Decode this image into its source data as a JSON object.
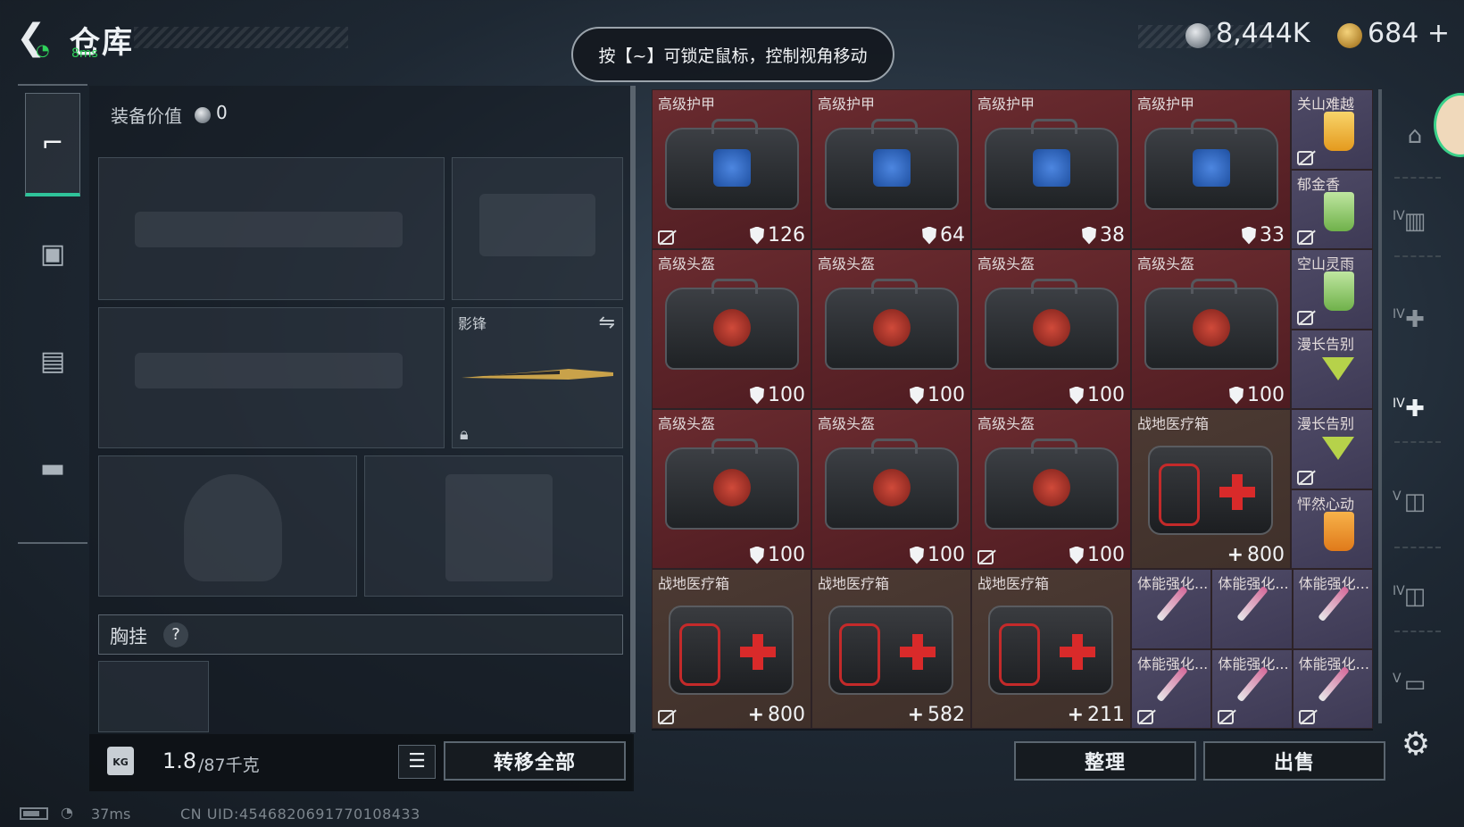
{
  "header": {
    "title": "仓库",
    "ping": "8ms",
    "hint": "按【~】可锁定鼠标，控制视角移动",
    "silver_amount": "8,444K",
    "gold_amount": "684",
    "gold_plus": "+"
  },
  "equipment": {
    "value_label": "装备价值",
    "value": "0",
    "melee_name": "影锋",
    "chest_label": "胸挂",
    "help": "?"
  },
  "weight": {
    "icon_text": "KG",
    "current": "1.8",
    "max": "/87千克"
  },
  "buttons": {
    "transfer_all": "转移全部",
    "sort": "整理",
    "sell": "出售"
  },
  "inventory": {
    "large": [
      {
        "name": "高级护甲",
        "count": "126",
        "type": "armor",
        "nodrop": true
      },
      {
        "name": "高级护甲",
        "count": "64",
        "type": "armor",
        "nodrop": false
      },
      {
        "name": "高级护甲",
        "count": "38",
        "type": "armor",
        "nodrop": false
      },
      {
        "name": "高级护甲",
        "count": "33",
        "type": "armor",
        "nodrop": false
      },
      {
        "name": "高级头盔",
        "count": "100",
        "type": "helmet",
        "nodrop": false
      },
      {
        "name": "高级头盔",
        "count": "100",
        "type": "helmet",
        "nodrop": false
      },
      {
        "name": "高级头盔",
        "count": "100",
        "type": "helmet",
        "nodrop": false
      },
      {
        "name": "高级头盔",
        "count": "100",
        "type": "helmet",
        "nodrop": false
      },
      {
        "name": "高级头盔",
        "count": "100",
        "type": "helmet",
        "nodrop": false
      },
      {
        "name": "高级头盔",
        "count": "100",
        "type": "helmet",
        "nodrop": false
      },
      {
        "name": "高级头盔",
        "count": "100",
        "type": "helmet",
        "nodrop": true
      },
      {
        "name": "战地医疗箱",
        "count": "800",
        "type": "medkit",
        "nodrop": false
      },
      {
        "name": "战地医疗箱",
        "count": "800",
        "type": "medkit",
        "nodrop": true
      },
      {
        "name": "战地医疗箱",
        "count": "582",
        "type": "medkit",
        "nodrop": false
      },
      {
        "name": "战地医疗箱",
        "count": "211",
        "type": "medkit",
        "nodrop": false
      }
    ],
    "drinks": [
      {
        "name": "关山难越",
        "color": "yellow",
        "nodrop": true
      },
      {
        "name": "郁金香",
        "color": "green",
        "nodrop": true
      },
      {
        "name": "空山灵雨",
        "color": "green",
        "nodrop": true
      },
      {
        "name": "漫长告别",
        "color": "martini",
        "nodrop": false
      },
      {
        "name": "漫长告别",
        "color": "martini",
        "nodrop": true
      },
      {
        "name": "怦然心动",
        "color": "orange",
        "nodrop": false
      }
    ],
    "syringes": [
      {
        "name": "体能强化...",
        "nodrop": false
      },
      {
        "name": "体能强化...",
        "nodrop": false
      },
      {
        "name": "体能强化...",
        "nodrop": false
      },
      {
        "name": "体能强化...",
        "nodrop": true
      },
      {
        "name": "体能强化...",
        "nodrop": true
      },
      {
        "name": "体能强化...",
        "nodrop": true
      }
    ]
  },
  "sidebar_right": {
    "labels": [
      "IV",
      "IV",
      "IV",
      "V",
      "IV",
      "V"
    ]
  },
  "footer": {
    "ping": "37ms",
    "uid": "CN UID:4546820691770108433"
  }
}
